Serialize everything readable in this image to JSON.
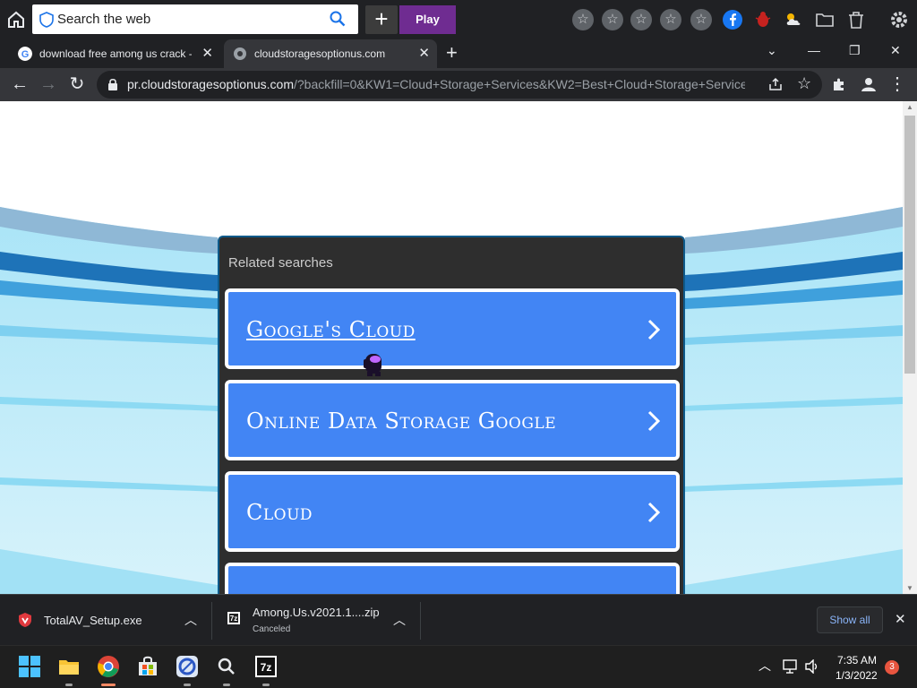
{
  "toolbar": {
    "search_text": "Search the web",
    "plus_label": "+",
    "play_label": "Play"
  },
  "tabs": [
    {
      "title": "download free among us crack -",
      "favicon": "google-icon"
    },
    {
      "title": "cloudstoragesoptionus.com",
      "favicon": "globe-icon",
      "active": true
    }
  ],
  "address": {
    "host": "pr.cloudstoragesoptionus.com",
    "path": "/?backfill=0&KW1=Cloud+Storage+Services&KW2=Best+Cloud+Storage+Service..."
  },
  "panel": {
    "title": "Related searches",
    "items": [
      {
        "label": "Google's Cloud"
      },
      {
        "label": "Online Data Storage Google"
      },
      {
        "label": "Cloud"
      },
      {
        "label": ""
      }
    ]
  },
  "downloads": [
    {
      "name": "TotalAV_Setup.exe",
      "status": ""
    },
    {
      "name": "Among.Us.v2021.1....zip",
      "status": "Canceled"
    }
  ],
  "show_all_label": "Show all",
  "clock": {
    "time": "7:35 AM",
    "date": "1/3/2022"
  },
  "notification_count": "3",
  "colors": {
    "button_blue": "#4285f4",
    "panel_bg": "#2e2e2e",
    "play_purple": "#6f2c91"
  }
}
